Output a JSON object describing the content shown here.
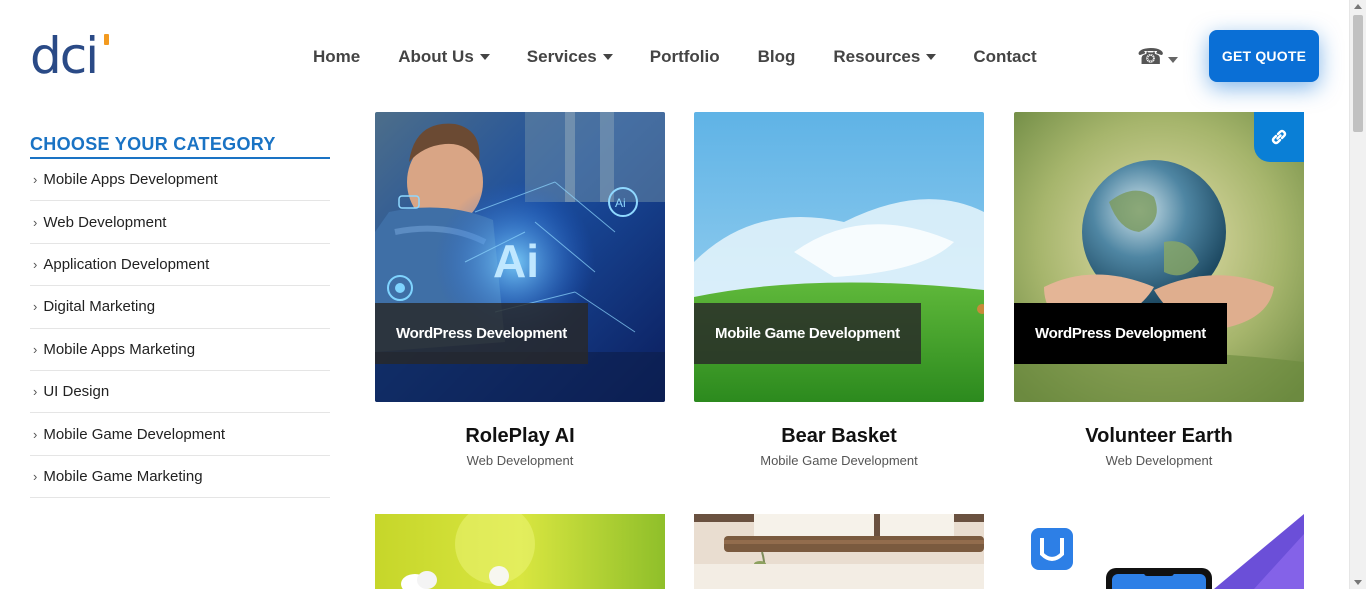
{
  "brand": {
    "logo_text": "dci",
    "accent": "#0a6fd6",
    "logo_color": "#2a4a86",
    "logo_dot_color": "#f39a1f"
  },
  "nav": {
    "items": [
      {
        "label": "Home",
        "has_dropdown": false
      },
      {
        "label": "About Us",
        "has_dropdown": true
      },
      {
        "label": "Services",
        "has_dropdown": true
      },
      {
        "label": "Portfolio",
        "has_dropdown": false
      },
      {
        "label": "Blog",
        "has_dropdown": false
      },
      {
        "label": "Resources",
        "has_dropdown": true
      },
      {
        "label": "Contact",
        "has_dropdown": false
      }
    ],
    "phone_icon": "☎",
    "quote_label": "GET QUOTE"
  },
  "sidebar": {
    "title": "CHOOSE YOUR CATEGORY",
    "items": [
      {
        "label": "Mobile Apps Development"
      },
      {
        "label": "Web Development"
      },
      {
        "label": "Application Development"
      },
      {
        "label": "Digital Marketing"
      },
      {
        "label": "Mobile Apps Marketing"
      },
      {
        "label": "UI Design"
      },
      {
        "label": "Mobile Game Development"
      },
      {
        "label": "Mobile Game Marketing"
      }
    ]
  },
  "portfolio": {
    "cards": [
      {
        "title": "RolePlay AI",
        "category": "Web Development",
        "tag": "WordPress Development",
        "image": "ai-developer-image"
      },
      {
        "title": "Bear Basket",
        "category": "Mobile Game Development",
        "tag": "Mobile Game Development",
        "image": "sky-meadow-image"
      },
      {
        "title": "Volunteer Earth",
        "category": "Web Development",
        "tag": "WordPress Development",
        "image": "hands-globe-image",
        "link_icon": "link-icon"
      }
    ],
    "next_row": [
      {
        "image": "flower-image"
      },
      {
        "image": "interior-image"
      },
      {
        "image": "universe-app-image"
      }
    ]
  }
}
